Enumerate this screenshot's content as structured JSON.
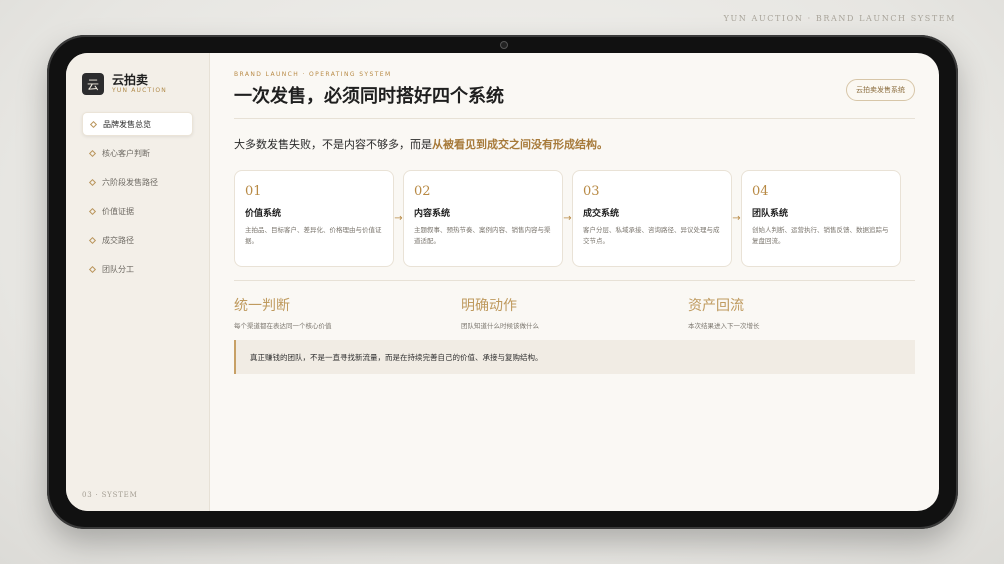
{
  "top_tag": "YUN AUCTION · BRAND LAUNCH SYSTEM",
  "sidebar": {
    "logo_char": "云",
    "brand_name": "云拍卖",
    "brand_sub": "YUN AUCTION",
    "items": [
      {
        "label": "品牌发售总览",
        "active": true
      },
      {
        "label": "核心客户判断"
      },
      {
        "label": "六阶段发售路径"
      },
      {
        "label": "价值证据"
      },
      {
        "label": "成交路径"
      },
      {
        "label": "团队分工"
      }
    ],
    "footer": "03 · SYSTEM"
  },
  "header": {
    "eyebrow": "BRAND LAUNCH · OPERATING SYSTEM",
    "title": "一次发售，必须同时搭好四个系统",
    "pill": "云拍卖发售系统"
  },
  "lead": {
    "prefix": "大多数发售失败，不是内容不够多，而是",
    "highlight": "从被看见到成交之间没有形成结构。"
  },
  "cards": [
    {
      "num": "01",
      "title": "价值系统",
      "desc": "主拍品、目标客户、差异化、价格理由与价值证据。"
    },
    {
      "num": "02",
      "title": "内容系统",
      "desc": "主题叙事、预热节奏、案例内容、销售内容与渠道适配。"
    },
    {
      "num": "03",
      "title": "成交系统",
      "desc": "客户分层、私域承接、咨询路径、异议处理与成交节点。"
    },
    {
      "num": "04",
      "title": "团队系统",
      "desc": "创始人判断、运营执行、销售反馈、数据追踪与复盘回流。"
    }
  ],
  "arrow_glyph": "→",
  "principles": [
    {
      "title": "统一判断",
      "sub": "每个渠道都在表达同一个核心价值"
    },
    {
      "title": "明确动作",
      "sub": "团队知道什么时候该做什么"
    },
    {
      "title": "资产回流",
      "sub": "本次结果进入下一次增长"
    }
  ],
  "quote": "真正赚钱的团队，不是一直寻找新流量，而是在持续完善自己的价值、承接与复购结构。",
  "colors": {
    "accent": "#b88a45",
    "sidebar_bg": "#f3efe8",
    "screen_bg": "#faf8f4"
  }
}
